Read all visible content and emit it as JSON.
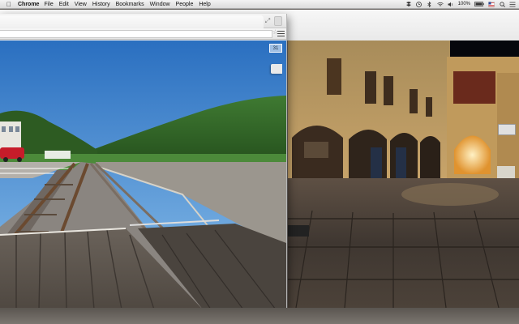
{
  "menubar": {
    "app_name": "Chrome",
    "items": [
      "File",
      "Edit",
      "View",
      "History",
      "Bookmarks",
      "Window",
      "People",
      "Help"
    ],
    "battery_text": "100%",
    "status_icons": [
      "dropbox-icon",
      "clock-icon",
      "bluetooth-icon",
      "wifi-icon",
      "volume-icon",
      "battery-icon",
      "flag-icon",
      "search-icon",
      "list-icon"
    ]
  },
  "browser": {
    "photo_badge": "31",
    "icons": [
      "resize-icon",
      "star-icon",
      "hamburger-menu-icon"
    ]
  },
  "colors": {
    "sky": "#3d7fc6",
    "hills": "#3c6a2a",
    "planks": "#5d554d",
    "castle_stone": "#b59a63"
  }
}
